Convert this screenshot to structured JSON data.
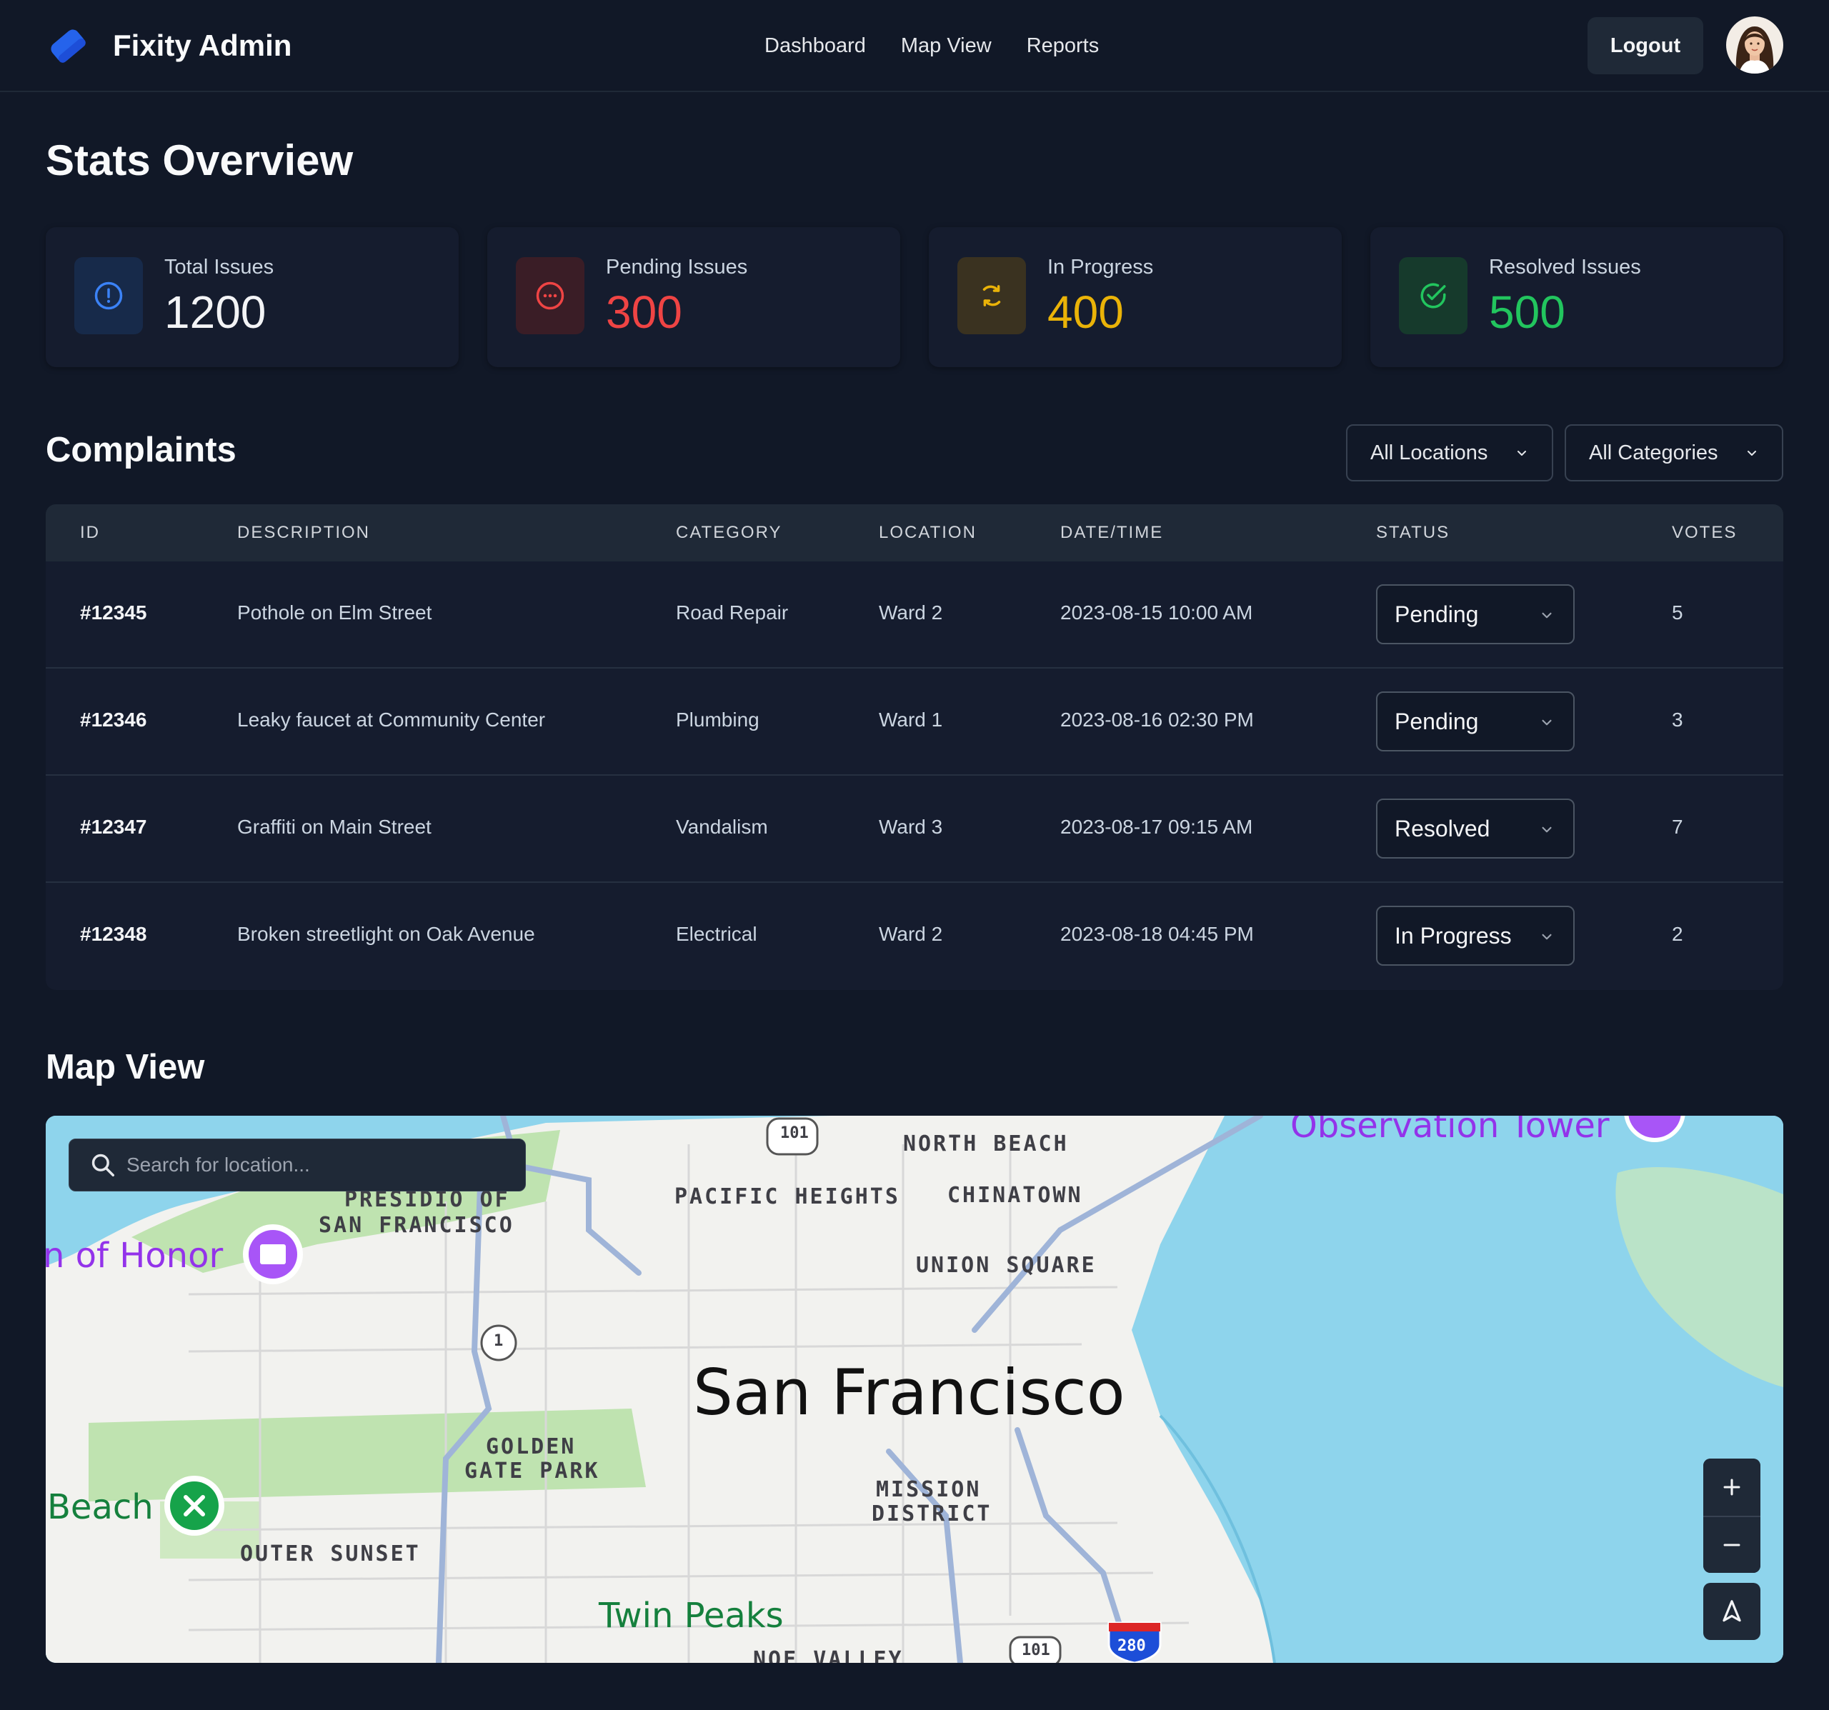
{
  "app": {
    "name": "Fixity Admin"
  },
  "nav": {
    "items": [
      "Dashboard",
      "Map View",
      "Reports"
    ],
    "logout_label": "Logout"
  },
  "colors": {
    "background": "#111827",
    "card": "#151c2e",
    "accent_blue": "#3b82f6",
    "total": "#f3f4f6",
    "pending": "#ef4444",
    "in_progress": "#eab308",
    "resolved": "#22c55e"
  },
  "stats": {
    "title": "Stats Overview",
    "cards": [
      {
        "label": "Total Issues",
        "value": "1200",
        "icon": "alert-circle-icon"
      },
      {
        "label": "Pending Issues",
        "value": "300",
        "icon": "more-horizontal-circle-icon"
      },
      {
        "label": "In Progress",
        "value": "400",
        "icon": "refresh-icon"
      },
      {
        "label": "Resolved Issues",
        "value": "500",
        "icon": "check-circle-icon"
      }
    ]
  },
  "complaints": {
    "title": "Complaints",
    "filters": {
      "location": "All Locations",
      "category": "All Categories"
    },
    "columns": [
      "ID",
      "DESCRIPTION",
      "CATEGORY",
      "LOCATION",
      "DATE/TIME",
      "STATUS",
      "VOTES"
    ],
    "rows": [
      {
        "id": "#12345",
        "description": "Pothole on Elm Street",
        "category": "Road Repair",
        "location": "Ward 2",
        "datetime": "2023-08-15 10:00 AM",
        "status": "Pending",
        "votes": "5"
      },
      {
        "id": "#12346",
        "description": "Leaky faucet at Community Center",
        "category": "Plumbing",
        "location": "Ward 1",
        "datetime": "2023-08-16 02:30 PM",
        "status": "Pending",
        "votes": "3"
      },
      {
        "id": "#12347",
        "description": "Graffiti on Main Street",
        "category": "Vandalism",
        "location": "Ward 3",
        "datetime": "2023-08-17 09:15 AM",
        "status": "Resolved",
        "votes": "7"
      },
      {
        "id": "#12348",
        "description": "Broken streetlight on Oak Avenue",
        "category": "Electrical",
        "location": "Ward 2",
        "datetime": "2023-08-18 04:45 PM",
        "status": "In Progress",
        "votes": "2"
      }
    ]
  },
  "map": {
    "title": "Map View",
    "search_placeholder": "Search for location...",
    "city": "San Francisco",
    "labels": {
      "north_beach": "NORTH BEACH",
      "pacific_heights": "PACIFIC HEIGHTS",
      "chinatown": "CHINATOWN",
      "presidio_1": "PRESIDIO OF",
      "presidio_2": "SAN FRANCISCO",
      "union_square": "UNION SQUARE",
      "golden_gate_1": "GOLDEN",
      "golden_gate_2": "GATE PARK",
      "mission_1": "MISSION",
      "mission_2": "DISTRICT",
      "outer_sunset": "OUTER SUNSET",
      "noe_valley": "NOE VALLEY"
    },
    "pois": {
      "legion": "n of Honor",
      "beach": "Beach",
      "twin_peaks": "Twin Peaks",
      "tower": "Observation Tower"
    },
    "shields": {
      "us101_top": "101",
      "us101_bottom": "101",
      "ca1": "1",
      "i280": "280"
    }
  }
}
